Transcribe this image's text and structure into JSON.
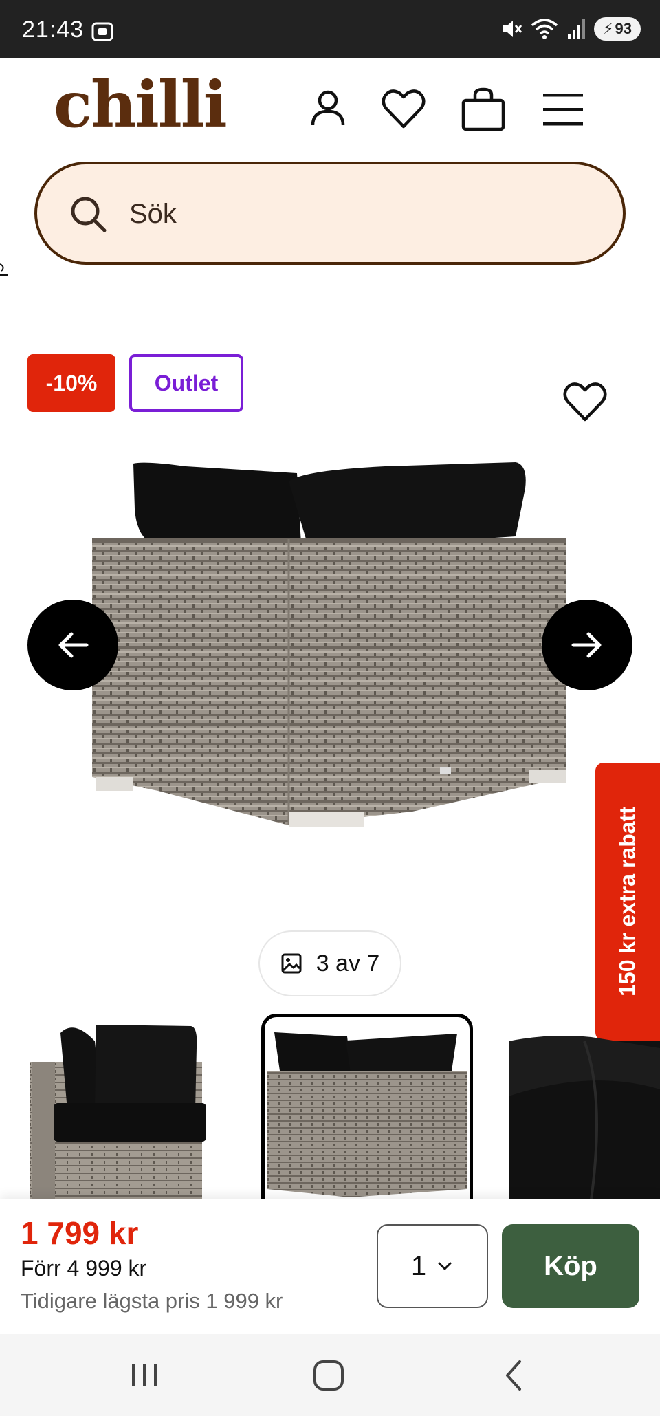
{
  "status_bar": {
    "time": "21:43",
    "battery": "93",
    "icons": [
      "screenshot-icon",
      "mute-icon",
      "wifi-icon",
      "signal-icon",
      "battery-icon"
    ]
  },
  "header": {
    "logo": "chilli",
    "icons": [
      "account-icon",
      "wishlist-heart-icon",
      "cart-bag-icon",
      "menu-hamburger-icon"
    ],
    "brand_color": "#5b2d0e"
  },
  "search": {
    "placeholder": "Sök",
    "bg_color": "#fdeee2"
  },
  "product": {
    "badges": {
      "discount": "-10%",
      "outlet": "Outlet"
    },
    "image_counter": "3 av 7",
    "current_image": 3,
    "total_images": 7,
    "thumbnails": [
      "thumbnail-1",
      "thumbnail-2",
      "thumbnail-3"
    ],
    "selected_thumbnail": 2
  },
  "promo": {
    "text": "150 kr extra rabatt",
    "color": "#e0250b"
  },
  "buy_bar": {
    "price": "1 799 kr",
    "price_before": "Förr 4 999 kr",
    "price_lowest": "Tidigare lägsta pris 1 999 kr",
    "quantity": "1",
    "buy_label": "Köp",
    "buy_color": "#3d5f3f"
  },
  "system_nav": [
    "recents-icon",
    "home-icon",
    "back-icon"
  ]
}
